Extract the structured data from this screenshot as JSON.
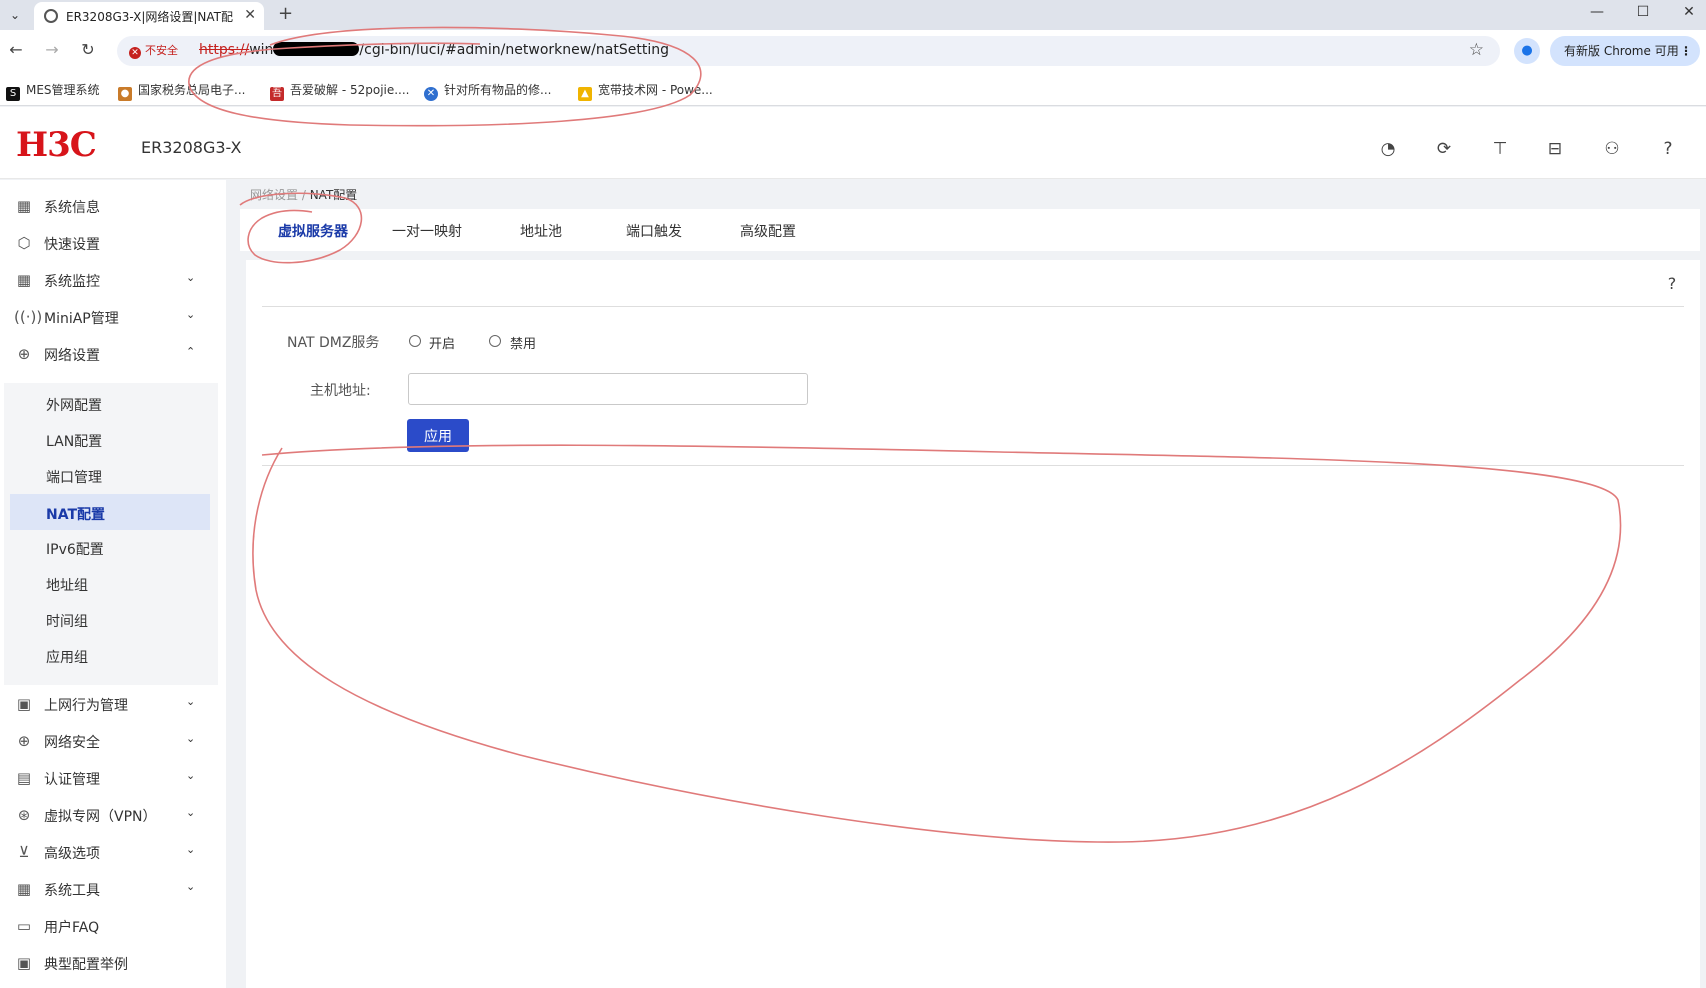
{
  "browser": {
    "tab_title": "ER3208G3-X|网络设置|NAT配",
    "security_label": "不安全",
    "url_scheme": "https://",
    "url_host_prefix": "win",
    "url_path": "/cgi-bin/luci/#admin/networknew/natSetting",
    "update_label": "有新版 Chrome 可用",
    "bookmarks": [
      {
        "label": "MES管理系统",
        "icon": "s-icon"
      },
      {
        "label": "国家税务总局电子...",
        "icon": "tax-icon"
      },
      {
        "label": "吾爱破解 - 52pojie....",
        "icon": "52pojie-icon"
      },
      {
        "label": "针对所有物品的修...",
        "icon": "x-circle-icon"
      },
      {
        "label": "宽带技术网 - Powe...",
        "icon": "broadband-icon"
      }
    ]
  },
  "header": {
    "logo": "H3C",
    "model": "ER3208G3-X"
  },
  "sidebar": {
    "top_items": [
      {
        "label": "系统信息",
        "icon": "grid-icon",
        "chevron": ""
      },
      {
        "label": "快速设置",
        "icon": "hexagon-icon",
        "chevron": ""
      },
      {
        "label": "系统监控",
        "icon": "grid-search-icon",
        "chevron": "v"
      },
      {
        "label": "MiniAP管理",
        "icon": "ap-icon",
        "chevron": "v"
      },
      {
        "label": "网络设置",
        "icon": "globe-gear-icon",
        "chevron": "^"
      }
    ],
    "sub_items": [
      {
        "label": "外网配置"
      },
      {
        "label": "LAN配置"
      },
      {
        "label": "端口管理"
      },
      {
        "label": "NAT配置"
      },
      {
        "label": "IPv6配置"
      },
      {
        "label": "地址组"
      },
      {
        "label": "时间组"
      },
      {
        "label": "应用组"
      }
    ],
    "bottom_items": [
      {
        "label": "上网行为管理",
        "icon": "behavior-icon",
        "chevron": "v"
      },
      {
        "label": "网络安全",
        "icon": "globe-lock-icon",
        "chevron": "v"
      },
      {
        "label": "认证管理",
        "icon": "auth-icon",
        "chevron": "v"
      },
      {
        "label": "虚拟专网（VPN）",
        "icon": "vpn-icon",
        "chevron": "v"
      },
      {
        "label": "高级选项",
        "icon": "filter-icon",
        "chevron": "v"
      },
      {
        "label": "系统工具",
        "icon": "tools-icon",
        "chevron": "v"
      },
      {
        "label": "用户FAQ",
        "icon": "chat-icon",
        "chevron": ""
      },
      {
        "label": "典型配置举例",
        "icon": "example-icon",
        "chevron": ""
      }
    ]
  },
  "breadcrumb": {
    "parent": "网络设置 / ",
    "current": "NAT配置"
  },
  "tabs": [
    {
      "label": "虚拟服务器",
      "active": true
    },
    {
      "label": "一对一映射",
      "active": false
    },
    {
      "label": "地址池",
      "active": false
    },
    {
      "label": "端口触发",
      "active": false
    },
    {
      "label": "高级配置",
      "active": false
    }
  ],
  "form": {
    "dmz_label": "NAT DMZ服务",
    "enable_label": "开启",
    "disable_label": "禁用",
    "host_label": "主机地址:",
    "host_value": "",
    "apply_label": "应用"
  },
  "colors": {
    "brand": "#d7141a",
    "accent": "#2b4bc9",
    "annotation": "#e07a7a"
  }
}
